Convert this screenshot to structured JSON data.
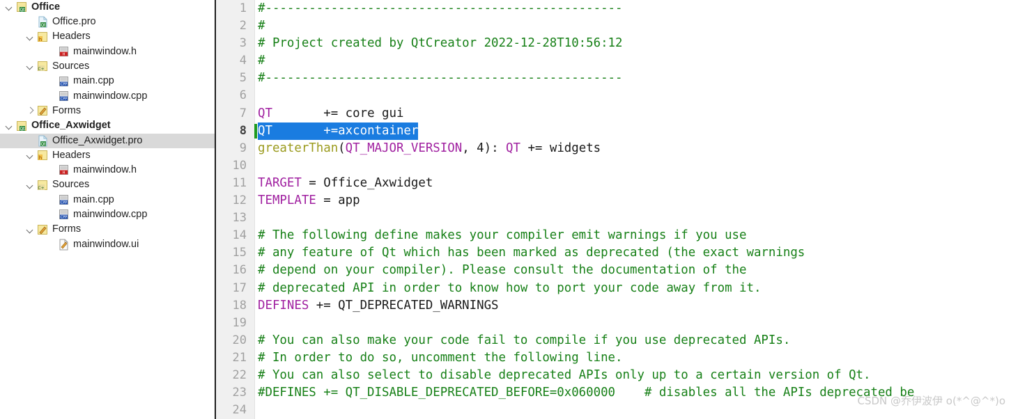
{
  "sidebar": {
    "rows": [
      {
        "label": "Office",
        "indent": 0,
        "chevron": "down",
        "icon": "qt-project-icon",
        "bold": true,
        "selected": false
      },
      {
        "label": "Office.pro",
        "indent": 1,
        "chevron": "none",
        "icon": "qt-pro-file-icon",
        "bold": false,
        "selected": false
      },
      {
        "label": "Headers",
        "indent": 1,
        "chevron": "down",
        "icon": "headers-folder-icon",
        "bold": false,
        "selected": false
      },
      {
        "label": "mainwindow.h",
        "indent": 2,
        "chevron": "none",
        "icon": "h-file-icon",
        "bold": false,
        "selected": false
      },
      {
        "label": "Sources",
        "indent": 1,
        "chevron": "down",
        "icon": "sources-folder-icon",
        "bold": false,
        "selected": false
      },
      {
        "label": "main.cpp",
        "indent": 2,
        "chevron": "none",
        "icon": "cpp-file-icon",
        "bold": false,
        "selected": false
      },
      {
        "label": "mainwindow.cpp",
        "indent": 2,
        "chevron": "none",
        "icon": "cpp-file-icon",
        "bold": false,
        "selected": false
      },
      {
        "label": "Forms",
        "indent": 1,
        "chevron": "right",
        "icon": "forms-folder-icon",
        "bold": false,
        "selected": false
      },
      {
        "label": "Office_Axwidget",
        "indent": 0,
        "chevron": "down",
        "icon": "qt-project-icon",
        "bold": true,
        "selected": false
      },
      {
        "label": "Office_Axwidget.pro",
        "indent": 1,
        "chevron": "none",
        "icon": "qt-pro-file-icon",
        "bold": false,
        "selected": true
      },
      {
        "label": "Headers",
        "indent": 1,
        "chevron": "down",
        "icon": "headers-folder-icon",
        "bold": false,
        "selected": false
      },
      {
        "label": "mainwindow.h",
        "indent": 2,
        "chevron": "none",
        "icon": "h-file-icon",
        "bold": false,
        "selected": false
      },
      {
        "label": "Sources",
        "indent": 1,
        "chevron": "down",
        "icon": "sources-folder-icon",
        "bold": false,
        "selected": false
      },
      {
        "label": "main.cpp",
        "indent": 2,
        "chevron": "none",
        "icon": "cpp-file-icon",
        "bold": false,
        "selected": false
      },
      {
        "label": "mainwindow.cpp",
        "indent": 2,
        "chevron": "none",
        "icon": "cpp-file-icon",
        "bold": false,
        "selected": false
      },
      {
        "label": "Forms",
        "indent": 1,
        "chevron": "down",
        "icon": "forms-folder-icon",
        "bold": false,
        "selected": false
      },
      {
        "label": "mainwindow.ui",
        "indent": 2,
        "chevron": "none",
        "icon": "ui-file-icon",
        "bold": false,
        "selected": false
      }
    ]
  },
  "editor": {
    "current_line": 8,
    "selection_line": 8,
    "lines": [
      {
        "n": "1",
        "tokens": [
          {
            "t": "#-------------------------------------------------",
            "c": "comment"
          }
        ]
      },
      {
        "n": "2",
        "tokens": [
          {
            "t": "#",
            "c": "comment"
          }
        ]
      },
      {
        "n": "3",
        "tokens": [
          {
            "t": "# Project created by QtCreator 2022-12-28T10:56:12",
            "c": "comment"
          }
        ]
      },
      {
        "n": "4",
        "tokens": [
          {
            "t": "#",
            "c": "comment"
          }
        ]
      },
      {
        "n": "5",
        "tokens": [
          {
            "t": "#-------------------------------------------------",
            "c": "comment"
          }
        ]
      },
      {
        "n": "6",
        "tokens": []
      },
      {
        "n": "7",
        "tokens": [
          {
            "t": "QT",
            "c": "var"
          },
          {
            "t": "       += core gui",
            "c": "plain"
          }
        ]
      },
      {
        "n": "8",
        "tokens": [
          {
            "t": "QT",
            "c": "var"
          },
          {
            "t": "       +=axcontainer",
            "c": "plain"
          }
        ],
        "selected": true
      },
      {
        "n": "9",
        "tokens": [
          {
            "t": "greaterThan",
            "c": "func"
          },
          {
            "t": "(",
            "c": "plain"
          },
          {
            "t": "QT_MAJOR_VERSION",
            "c": "var"
          },
          {
            "t": ", 4): ",
            "c": "plain"
          },
          {
            "t": "QT",
            "c": "var"
          },
          {
            "t": " += widgets",
            "c": "plain"
          }
        ]
      },
      {
        "n": "10",
        "tokens": []
      },
      {
        "n": "11",
        "tokens": [
          {
            "t": "TARGET",
            "c": "var"
          },
          {
            "t": " = Office_Axwidget",
            "c": "plain"
          }
        ]
      },
      {
        "n": "12",
        "tokens": [
          {
            "t": "TEMPLATE",
            "c": "var"
          },
          {
            "t": " = app",
            "c": "plain"
          }
        ]
      },
      {
        "n": "13",
        "tokens": []
      },
      {
        "n": "14",
        "tokens": [
          {
            "t": "# The following define makes your compiler emit warnings if you use",
            "c": "comment"
          }
        ]
      },
      {
        "n": "15",
        "tokens": [
          {
            "t": "# any feature of Qt which has been marked as deprecated (the exact warnings",
            "c": "comment"
          }
        ]
      },
      {
        "n": "16",
        "tokens": [
          {
            "t": "# depend on your compiler). Please consult the documentation of the",
            "c": "comment"
          }
        ]
      },
      {
        "n": "17",
        "tokens": [
          {
            "t": "# deprecated API in order to know how to port your code away from it.",
            "c": "comment"
          }
        ]
      },
      {
        "n": "18",
        "tokens": [
          {
            "t": "DEFINES",
            "c": "var"
          },
          {
            "t": " += QT_DEPRECATED_WARNINGS",
            "c": "plain"
          }
        ]
      },
      {
        "n": "19",
        "tokens": []
      },
      {
        "n": "20",
        "tokens": [
          {
            "t": "# You can also make your code fail to compile if you use deprecated APIs.",
            "c": "comment"
          }
        ]
      },
      {
        "n": "21",
        "tokens": [
          {
            "t": "# In order to do so, uncomment the following line.",
            "c": "comment"
          }
        ]
      },
      {
        "n": "22",
        "tokens": [
          {
            "t": "# You can also select to disable deprecated APIs only up to a certain version of Qt.",
            "c": "comment"
          }
        ]
      },
      {
        "n": "23",
        "tokens": [
          {
            "t": "#DEFINES += QT_DISABLE_DEPRECATED_BEFORE=0x060000    # disables all the APIs deprecated be",
            "c": "comment"
          }
        ]
      },
      {
        "n": "24",
        "tokens": []
      }
    ]
  },
  "watermark": {
    "text": "CSDN @乔伊波伊 o(*^@^*)o"
  },
  "colors": {
    "comment": "#178017",
    "variable": "#a020a0",
    "function": "#9b9b1e",
    "selection_bg": "#1a7ce0",
    "gutter_bg": "#f0f0f0",
    "row_selected_bg": "#d9d9d9",
    "divider": "#1c1c1c"
  }
}
